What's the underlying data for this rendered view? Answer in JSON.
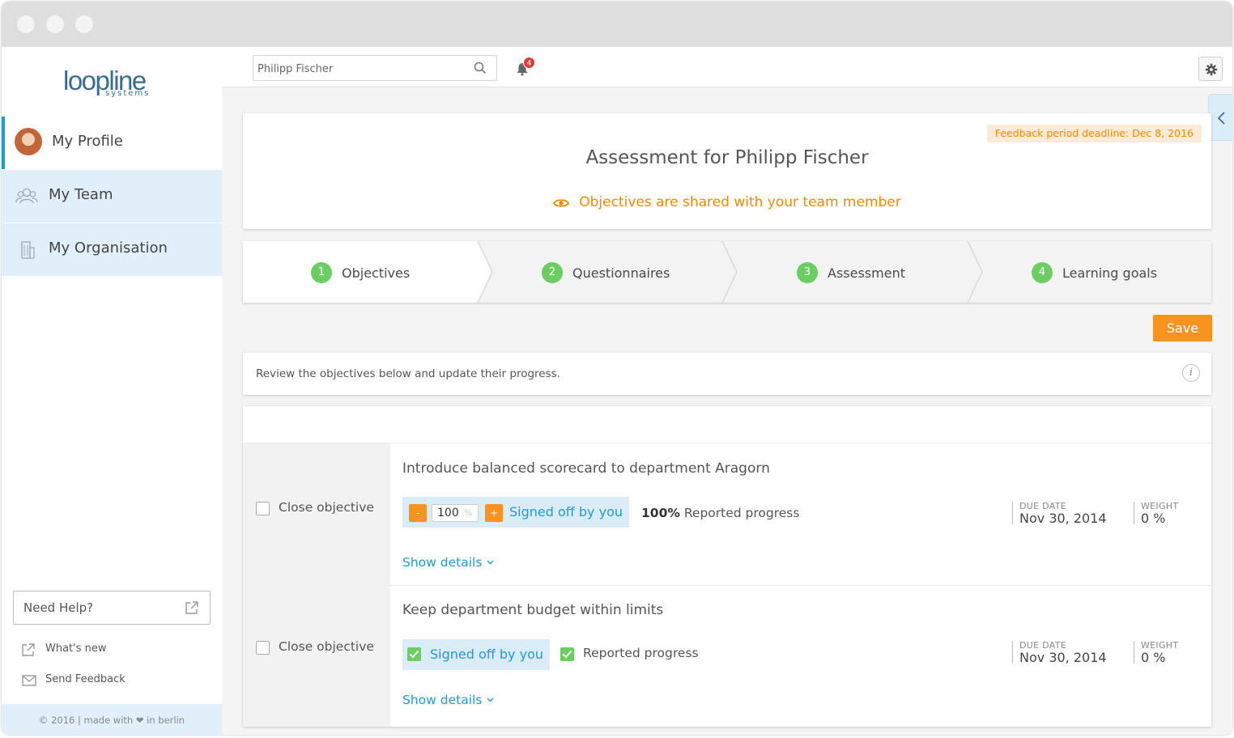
{
  "app": {
    "logo_main": "loopline",
    "logo_sub": "systems"
  },
  "sidebar": {
    "items": [
      {
        "label": "My Profile",
        "icon": "avatar",
        "active": true
      },
      {
        "label": "My Team",
        "icon": "team-icon",
        "active": false
      },
      {
        "label": "My Organisation",
        "icon": "building-icon",
        "active": false
      }
    ],
    "help_label": "Need Help?",
    "links": [
      {
        "label": "What's new",
        "icon": "external-link-icon"
      },
      {
        "label": "Send Feedback",
        "icon": "envelope-icon"
      }
    ],
    "footer": "© 2016 | made with ❤ in berlin"
  },
  "topbar": {
    "search_value": "Philipp Fischer",
    "notification_count": "4"
  },
  "header": {
    "deadline": "Feedback period deadline: Dec 8, 2016",
    "title": "Assessment for Philipp Fischer",
    "shared_notice": "Objectives are shared with your team member"
  },
  "steps": [
    {
      "num": "1",
      "label": "Objectives",
      "active": true
    },
    {
      "num": "2",
      "label": "Questionnaires",
      "active": false
    },
    {
      "num": "3",
      "label": "Assessment",
      "active": false
    },
    {
      "num": "4",
      "label": "Learning goals",
      "active": false
    }
  ],
  "actions": {
    "save_label": "Save"
  },
  "info": {
    "text": "Review the objectives below and update their progress.",
    "icon_glyph": "i"
  },
  "objectives": [
    {
      "close_label": "Close objective",
      "title": "Introduce balanced scorecard to department Aragorn",
      "minus": "-",
      "plus": "+",
      "progress_value": "100",
      "progress_unit": "%",
      "signed_label": "Signed off by you",
      "reported_strong": "100%",
      "reported_label": "Reported progress",
      "due_key": "DUE DATE",
      "due_value": "Nov 30, 2014",
      "weight_key": "WEIGHT",
      "weight_value": "0 %",
      "show_details": "Show details"
    },
    {
      "close_label": "Close objective",
      "title": "Keep department budget within limits",
      "signed_label": "Signed off by you",
      "reported_label": "Reported progress",
      "due_key": "DUE DATE",
      "due_value": "Nov 30, 2014",
      "weight_key": "WEIGHT",
      "weight_value": "0 %",
      "show_details": "Show details"
    }
  ],
  "colors": {
    "accent_blue": "#1e9bd7",
    "accent_orange": "#f7931e",
    "step_green": "#6ccd63",
    "nav_highlight": "#e0eff9",
    "badge_red": "#e53935"
  }
}
